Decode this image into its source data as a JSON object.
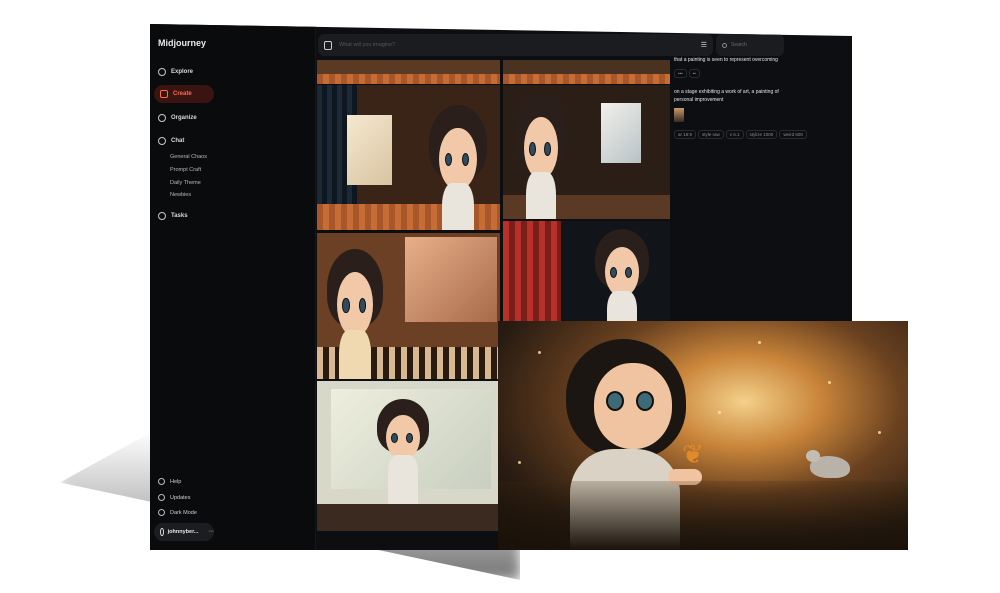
{
  "app": {
    "brand": "Midjourney"
  },
  "sidebar": {
    "nav": [
      {
        "label": "Explore",
        "icon": "compass-icon"
      },
      {
        "label": "Create",
        "icon": "create-icon",
        "active": true
      },
      {
        "label": "Organize",
        "icon": "folder-icon"
      },
      {
        "label": "Chat",
        "icon": "chat-icon"
      }
    ],
    "chat_rooms": [
      "General Chaos",
      "Prompt Craft",
      "Daily Theme",
      "Newbies"
    ],
    "tasks": {
      "label": "Tasks",
      "icon": "thumbs-up-icon"
    },
    "footer": [
      {
        "label": "Help",
        "icon": "help-icon"
      },
      {
        "label": "Updates",
        "icon": "bell-icon"
      },
      {
        "label": "Dark Mode",
        "icon": "moon-icon"
      }
    ],
    "user": {
      "name": "johnnyber...",
      "menu": "···"
    }
  },
  "topbar": {
    "prompt_placeholder": "What will you imagine?",
    "search_placeholder": "Search"
  },
  "panel": {
    "prompt1": "that a painting is seen to represent overcoming",
    "prompt2": "on a stage exhibiting a work of art, a painting of personal improvement",
    "params": [
      "ar 16:9",
      "style raw",
      "v 6.1",
      "stylize 1000",
      "weird 600"
    ]
  },
  "colors": {
    "accent": "#ff6a4a",
    "background": "#0d0e11"
  }
}
